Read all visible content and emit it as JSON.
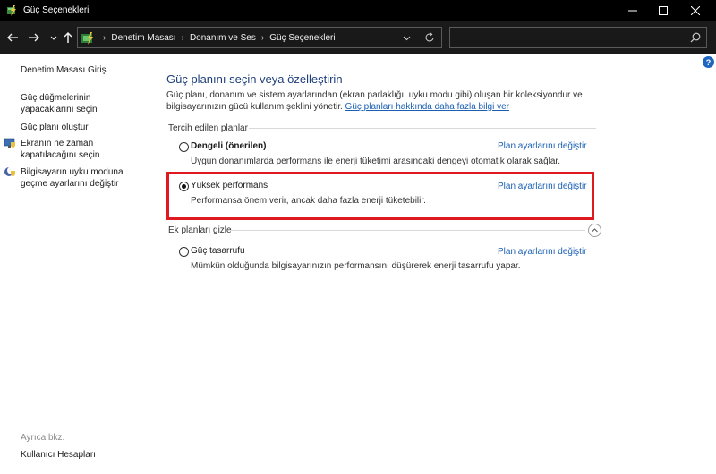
{
  "window": {
    "title": "Güç Seçenekleri"
  },
  "address": {
    "crumbs": [
      "Denetim Masası",
      "Donanım ve Ses",
      "Güç Seçenekleri"
    ],
    "search_placeholder": ""
  },
  "help": {
    "label": "?"
  },
  "sidebar": {
    "links": [
      {
        "label": "Denetim Masası Giriş"
      },
      {
        "label_line1": "Güç düğmelerinin",
        "label_line2": "yapacaklarını seçin"
      },
      {
        "label": "Güç planı oluştur"
      },
      {
        "label_line1": "Ekranın ne zaman",
        "label_line2": "kapatılacağını seçin"
      },
      {
        "label_line1": "Bilgisayarın uyku moduna",
        "label_line2": "geçme ayarlarını değiştir"
      }
    ],
    "see_also": "Ayrıca bkz.",
    "user_accounts": "Kullanıcı Hesapları"
  },
  "main": {
    "title": "Güç planını seçin veya özelleştirin",
    "desc_line1": "Güç planı, donanım ve sistem ayarlarından (ekran parlaklığı, uyku modu gibi) oluşan bir koleksiyondur ve",
    "desc_line2": "bilgisayarınızın gücü kullanım şeklini yönetir.",
    "desc_link": "Güç planları hakkında daha fazla bilgi ver",
    "preferred_label": "Tercih edilen planlar",
    "hide_label": "Ek planları gizle",
    "plans": [
      {
        "name": "Dengeli (önerilen)",
        "desc": "Uygun donanımlarda performans ile enerji tüketimi arasındaki dengeyi otomatik olarak sağlar.",
        "link": "Plan ayarlarını değiştir",
        "selected": false
      },
      {
        "name": "Yüksek performans",
        "desc": "Performansa önem verir, ancak daha fazla enerji tüketebilir.",
        "link": "Plan ayarlarını değiştir",
        "selected": true
      },
      {
        "name": "Güç tasarrufu",
        "desc": "Mümkün olduğunda bilgisayarınızın performansını düşürerek enerji tasarrufu yapar.",
        "link": "Plan ayarlarını değiştir",
        "selected": false
      }
    ]
  },
  "colors": {
    "highlight": "#e0181f",
    "link": "#1a5fb4",
    "title": "#1f3f7a"
  }
}
